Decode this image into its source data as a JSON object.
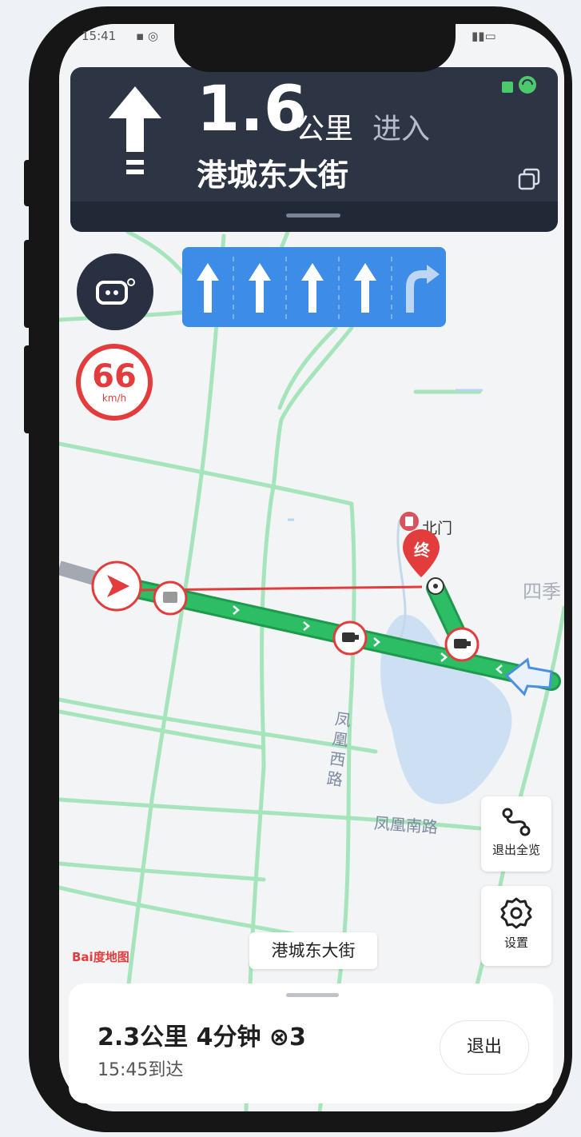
{
  "status_bar": {
    "time": "15:41"
  },
  "navigation": {
    "distance": "1.6",
    "unit": "公里",
    "action": "进入",
    "road": "港城东大街"
  },
  "speed_limit": {
    "value": "66",
    "unit": "km/h"
  },
  "lanes": [
    "straight-arrow-icon",
    "straight-arrow-icon",
    "straight-arrow-icon",
    "straight-arrow-icon",
    "right-turn-arrow-icon"
  ],
  "map": {
    "roads": [
      "凤凰西路",
      "凤凰南路"
    ],
    "place": "四季",
    "poi": "北门",
    "destination_marker": "终",
    "current_street": "港城东大街",
    "logo": "Bai度地图"
  },
  "buttons": {
    "overview": "退出全览",
    "settings": "设置",
    "exit": "退出"
  },
  "trip": {
    "summary": "2.3公里 4分钟 ⊗3",
    "arrival": "15:45到达"
  },
  "colors": {
    "route": "#2dbd64",
    "nav_card": "#2d3544",
    "lane_panel": "#3d8ce8",
    "alert_red": "#e33c3c"
  }
}
